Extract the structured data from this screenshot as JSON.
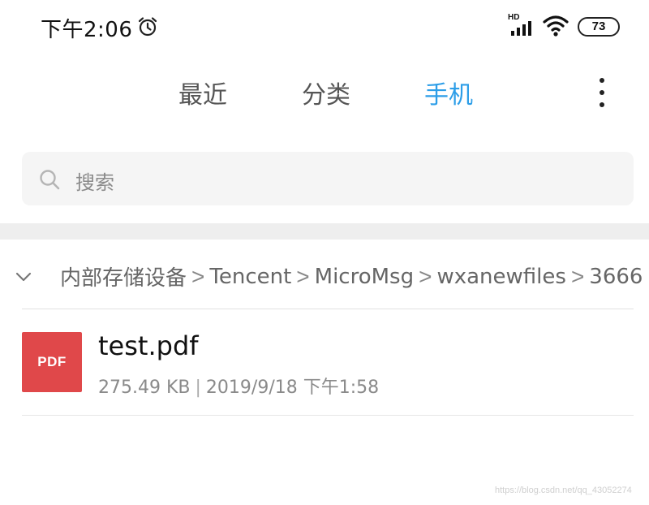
{
  "status_bar": {
    "time": "下午2:06",
    "network_label": "HD",
    "battery_level": "73"
  },
  "tabs": [
    {
      "label": "最近",
      "active": false
    },
    {
      "label": "分类",
      "active": false
    },
    {
      "label": "手机",
      "active": true
    }
  ],
  "colors": {
    "active_tab": "#2d9ee8",
    "pdf_icon_bg": "#e0484a"
  },
  "search": {
    "placeholder": "搜索"
  },
  "breadcrumb": {
    "items": [
      "内部存储设备",
      "Tencent",
      "MicroMsg",
      "wxanewfiles",
      "3666"
    ],
    "separator": ">"
  },
  "files": [
    {
      "icon_label": "PDF",
      "name": "test.pdf",
      "size": "275.49 KB",
      "meta_separator": "|",
      "modified": "2019/9/18 下午1:58"
    }
  ],
  "watermark": "https://blog.csdn.net/qq_43052274"
}
